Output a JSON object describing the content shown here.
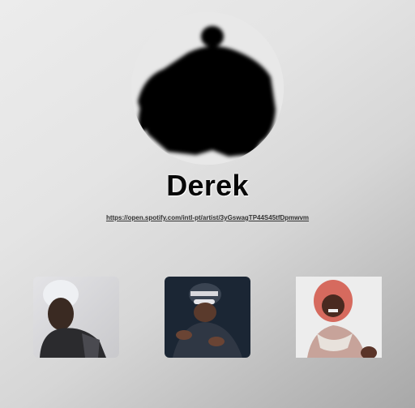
{
  "profile": {
    "name": "Derek",
    "link": "https://open.spotify.com/intl-pt/artist/3yGswagTP44S45tfDpmwvm"
  },
  "photos": [
    {
      "icon": "artist-photo"
    },
    {
      "icon": "artist-photo"
    },
    {
      "icon": "artist-photo"
    }
  ]
}
